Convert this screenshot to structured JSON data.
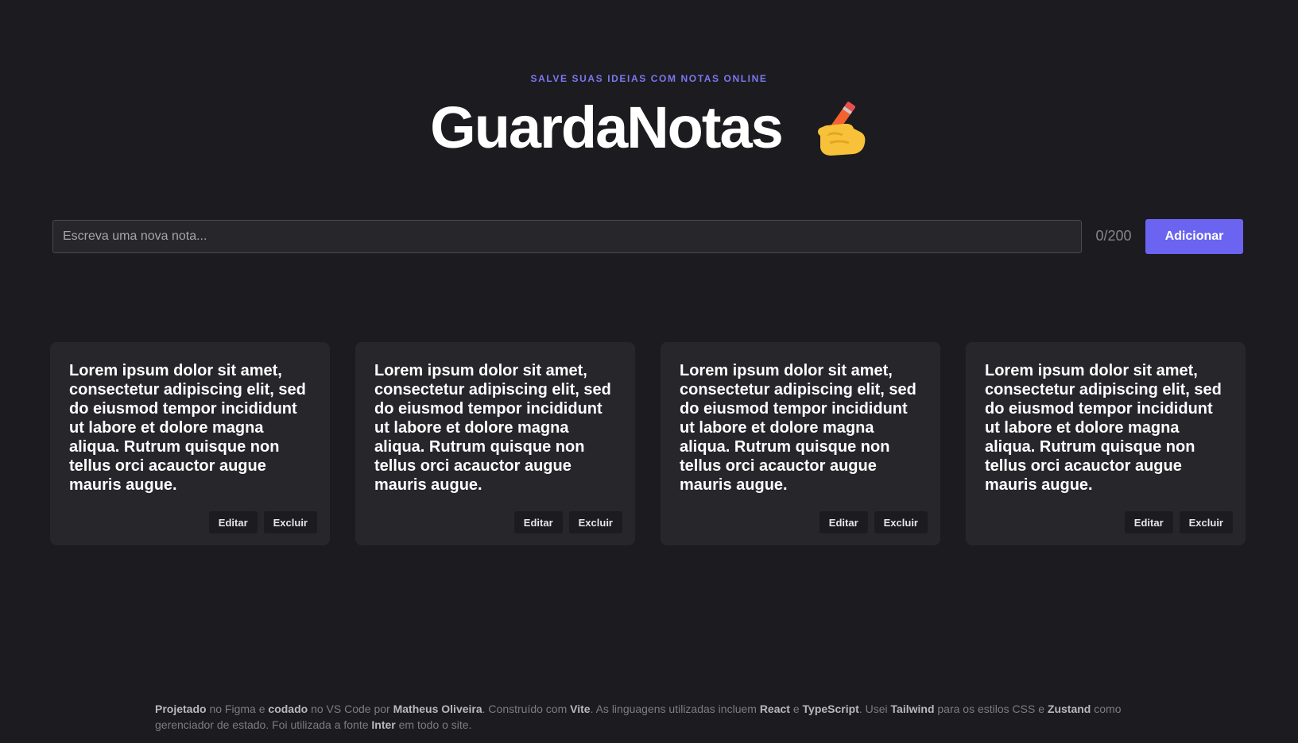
{
  "header": {
    "tagline": "SALVE SUAS IDEIAS COM NOTAS ONLINE",
    "title": "GuardaNotas",
    "title_icon": "writing-hand-icon"
  },
  "composer": {
    "placeholder": "Escreva uma nova nota...",
    "value": "",
    "counter": "0/200",
    "add_label": "Adicionar"
  },
  "notes": [
    {
      "text": "Lorem ipsum dolor sit amet, consectetur adipiscing elit, sed do eiusmod tempor incididunt ut labore et dolore magna aliqua. Rutrum quisque non tellus orci acauctor augue mauris augue.",
      "edit_label": "Editar",
      "delete_label": "Excluir"
    },
    {
      "text": "Lorem ipsum dolor sit amet, consectetur adipiscing elit, sed do eiusmod tempor incididunt ut labore et dolore magna aliqua. Rutrum quisque non tellus orci acauctor augue mauris augue.",
      "edit_label": "Editar",
      "delete_label": "Excluir"
    },
    {
      "text": "Lorem ipsum dolor sit amet, consectetur adipiscing elit, sed do eiusmod tempor incididunt ut labore et dolore magna aliqua. Rutrum quisque non tellus orci acauctor augue mauris augue.",
      "edit_label": "Editar",
      "delete_label": "Excluir"
    },
    {
      "text": "Lorem ipsum dolor sit amet, consectetur adipiscing elit, sed do eiusmod tempor incididunt ut labore et dolore magna aliqua. Rutrum quisque non tellus orci acauctor augue mauris augue.",
      "edit_label": "Editar",
      "delete_label": "Excluir"
    }
  ],
  "footer": {
    "p1": "Projetado",
    "t1": " no Figma e ",
    "p2": "codado",
    "t2": " no VS Code por ",
    "p3": "Matheus Oliveira",
    "t3": ". Construído com ",
    "p4": "Vite",
    "t4": ". As linguagens utilizadas incluem ",
    "p5": "React",
    "t5": " e ",
    "p6": "TypeScript",
    "t6": ". Usei ",
    "p7": "Tailwind",
    "t7": " para os estilos CSS e ",
    "p8": "Zustand",
    "t8": " como gerenciador de estado. Foi utilizada a fonte ",
    "p9": "Inter",
    "t9": " em todo o site."
  },
  "colors": {
    "background": "#1c1b1f",
    "card": "#27262b",
    "accent": "#6a64f1",
    "tagline": "#7b78f2"
  }
}
